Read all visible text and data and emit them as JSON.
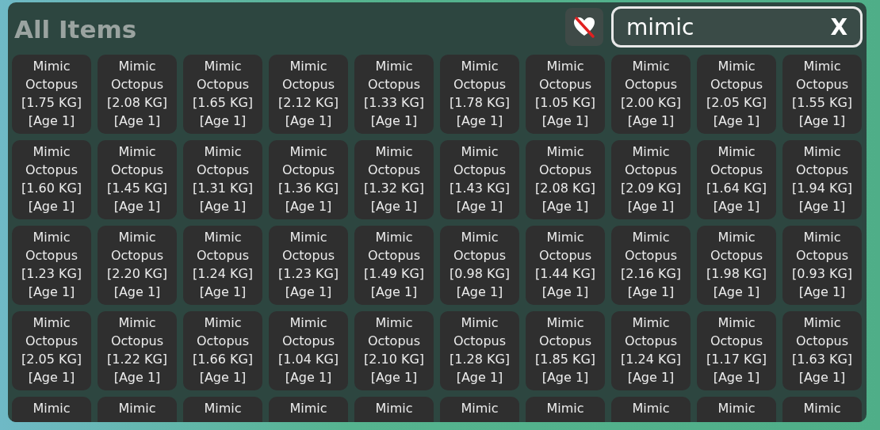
{
  "title": "All Items",
  "search": {
    "value": "mimic",
    "clear_label": "X"
  },
  "items": [
    {
      "lines": [
        "Mimic",
        "Octopus",
        "[1.75 KG]",
        "[Age 1]"
      ]
    },
    {
      "lines": [
        "Mimic",
        "Octopus",
        "[2.08 KG]",
        "[Age 1]"
      ]
    },
    {
      "lines": [
        "Mimic",
        "Octopus",
        "[1.65 KG]",
        "[Age 1]"
      ]
    },
    {
      "lines": [
        "Mimic",
        "Octopus",
        "[2.12 KG]",
        "[Age 1]"
      ]
    },
    {
      "lines": [
        "Mimic",
        "Octopus",
        "[1.33 KG]",
        "[Age 1]"
      ]
    },
    {
      "lines": [
        "Mimic",
        "Octopus",
        "[1.78 KG]",
        "[Age 1]"
      ]
    },
    {
      "lines": [
        "Mimic",
        "Octopus",
        "[1.05 KG]",
        "[Age 1]"
      ]
    },
    {
      "lines": [
        "Mimic",
        "Octopus",
        "[2.00 KG]",
        "[Age 1]"
      ]
    },
    {
      "lines": [
        "Mimic",
        "Octopus",
        "[2.05 KG]",
        "[Age 1]"
      ]
    },
    {
      "lines": [
        "Mimic",
        "Octopus",
        "[1.55 KG]",
        "[Age 1]"
      ]
    },
    {
      "lines": [
        "Mimic",
        "Octopus",
        "[1.60 KG]",
        "[Age 1]"
      ]
    },
    {
      "lines": [
        "Mimic",
        "Octopus",
        "[1.45 KG]",
        "[Age 1]"
      ]
    },
    {
      "lines": [
        "Mimic",
        "Octopus",
        "[1.31 KG]",
        "[Age 1]"
      ]
    },
    {
      "lines": [
        "Mimic",
        "Octopus",
        "[1.36 KG]",
        "[Age 1]"
      ]
    },
    {
      "lines": [
        "Mimic",
        "Octopus",
        "[1.32 KG]",
        "[Age 1]"
      ]
    },
    {
      "lines": [
        "Mimic",
        "Octopus",
        "[1.43 KG]",
        "[Age 1]"
      ]
    },
    {
      "lines": [
        "Mimic",
        "Octopus",
        "[2.08 KG]",
        "[Age 1]"
      ]
    },
    {
      "lines": [
        "Mimic",
        "Octopus",
        "[2.09 KG]",
        "[Age 1]"
      ]
    },
    {
      "lines": [
        "Mimic",
        "Octopus",
        "[1.64 KG]",
        "[Age 1]"
      ]
    },
    {
      "lines": [
        "Mimic",
        "Octopus",
        "[1.94 KG]",
        "[Age 1]"
      ]
    },
    {
      "lines": [
        "Mimic",
        "Octopus",
        "[1.23 KG]",
        "[Age 1]"
      ]
    },
    {
      "lines": [
        "Mimic",
        "Octopus",
        "[2.20 KG]",
        "[Age 1]"
      ]
    },
    {
      "lines": [
        "Mimic",
        "Octopus",
        "[1.24 KG]",
        "[Age 1]"
      ]
    },
    {
      "lines": [
        "Mimic",
        "Octopus",
        "[1.23 KG]",
        "[Age 1]"
      ]
    },
    {
      "lines": [
        "Mimic",
        "Octopus",
        "[1.49 KG]",
        "[Age 1]"
      ]
    },
    {
      "lines": [
        "Mimic",
        "Octopus",
        "[0.98 KG]",
        "[Age 1]"
      ]
    },
    {
      "lines": [
        "Mimic",
        "Octopus",
        "[1.44 KG]",
        "[Age 1]"
      ]
    },
    {
      "lines": [
        "Mimic",
        "Octopus",
        "[2.16 KG]",
        "[Age 1]"
      ]
    },
    {
      "lines": [
        "Mimic",
        "Octopus",
        "[1.98 KG]",
        "[Age 1]"
      ]
    },
    {
      "lines": [
        "Mimic",
        "Octopus",
        "[0.93 KG]",
        "[Age 1]"
      ]
    },
    {
      "lines": [
        "Mimic",
        "Octopus",
        "[2.05 KG]",
        "[Age 1]"
      ]
    },
    {
      "lines": [
        "Mimic",
        "Octopus",
        "[1.22 KG]",
        "[Age 1]"
      ]
    },
    {
      "lines": [
        "Mimic",
        "Octopus",
        "[1.66 KG]",
        "[Age 1]"
      ]
    },
    {
      "lines": [
        "Mimic",
        "Octopus",
        "[1.04 KG]",
        "[Age 1]"
      ]
    },
    {
      "lines": [
        "Mimic",
        "Octopus",
        "[2.10 KG]",
        "[Age 1]"
      ]
    },
    {
      "lines": [
        "Mimic",
        "Octopus",
        "[1.28 KG]",
        "[Age 1]"
      ]
    },
    {
      "lines": [
        "Mimic",
        "Octopus",
        "[1.85 KG]",
        "[Age 1]"
      ]
    },
    {
      "lines": [
        "Mimic",
        "Octopus",
        "[1.24 KG]",
        "[Age 1]"
      ]
    },
    {
      "lines": [
        "Mimic",
        "Octopus",
        "[1.17 KG]",
        "[Age 1]"
      ]
    },
    {
      "lines": [
        "Mimic",
        "Octopus",
        "[1.63 KG]",
        "[Age 1]"
      ]
    },
    {
      "lines": [
        "Mimic"
      ]
    },
    {
      "lines": [
        "Mimic"
      ]
    },
    {
      "lines": [
        "Mimic"
      ]
    },
    {
      "lines": [
        "Mimic"
      ]
    },
    {
      "lines": [
        "Mimic"
      ]
    },
    {
      "lines": [
        "Mimic"
      ]
    },
    {
      "lines": [
        "Mimic"
      ]
    },
    {
      "lines": [
        "Mimic"
      ]
    },
    {
      "lines": [
        "Mimic"
      ]
    },
    {
      "lines": [
        "Mimic"
      ]
    }
  ]
}
